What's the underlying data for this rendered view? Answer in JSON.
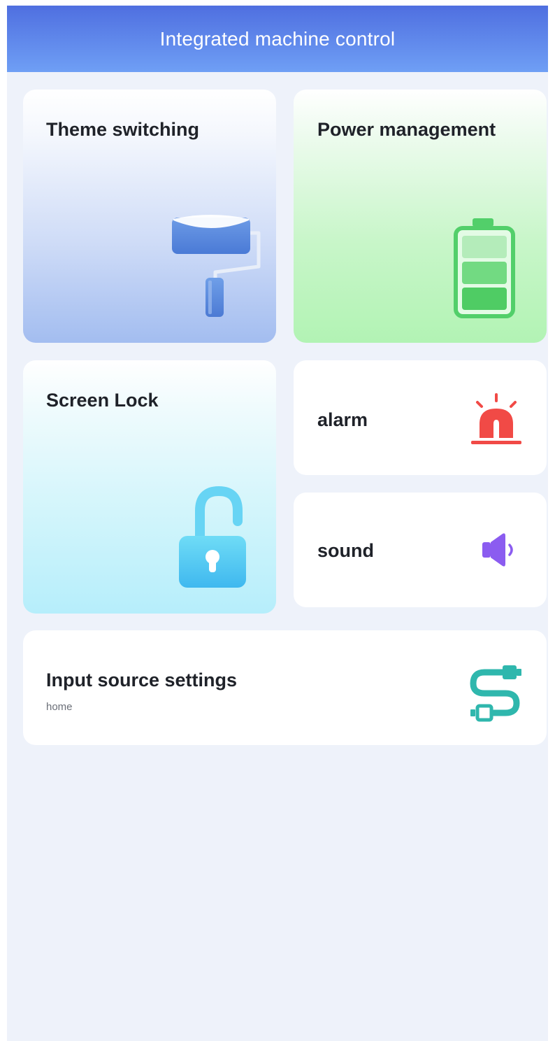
{
  "header": {
    "title": "Integrated machine control"
  },
  "cards": {
    "theme": {
      "title": "Theme switching",
      "icon": "paint-roller-icon"
    },
    "power": {
      "title": "Power management",
      "icon": "battery-icon"
    },
    "lock": {
      "title": "Screen Lock",
      "icon": "unlocked-padlock-icon"
    },
    "alarm": {
      "title": "alarm",
      "icon": "alarm-siren-icon",
      "color": "#f14a46"
    },
    "sound": {
      "title": "sound",
      "icon": "speaker-icon",
      "color": "#8b5cf0"
    },
    "input": {
      "title": "Input source settings",
      "subtitle": "home",
      "icon": "cable-icon",
      "color": "#2fb7ad"
    }
  },
  "colors": {
    "header_start": "#4f6fe0",
    "header_end": "#6f9ff5",
    "background": "#eef2fa"
  }
}
